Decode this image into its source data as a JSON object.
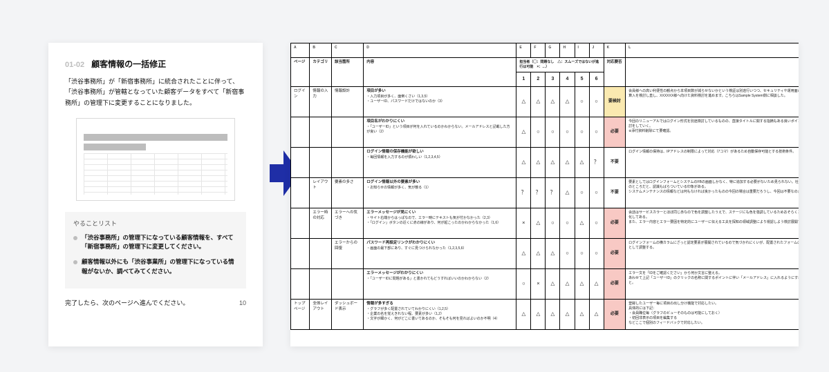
{
  "left_card": {
    "number": "01-02",
    "title": "顧客情報の一括修正",
    "description": "「渋谷事務所」が「新宿事務所」に統合されたことに伴って、「渋谷事務所」が管轄となっていた顧客データをすべて「新宿事務所」の管理下に変更することになりました。",
    "todo_title": "やることリスト",
    "todos": [
      "「渋谷事務所」の管理下になっている顧客情報を、すべて「新宿事務所」の管理下に変更してください。",
      "顧客情報以外にも「渋谷事業所」の管理下になっている情報がないか、調べてみてください。"
    ],
    "footer_text": "完了したら、次のページへ進んでください。",
    "page_number": "10"
  },
  "right_table": {
    "col_letters": [
      "A",
      "B",
      "C",
      "D",
      "E",
      "F",
      "G",
      "H",
      "I",
      "J",
      "K",
      "L"
    ],
    "headers": {
      "page": "ページ",
      "category": "カテゴリ",
      "location": "該当箇所",
      "content": "内容",
      "rating_legend": "担当者（◯：問題なし　△：スムーズではないが進行は可能　×：…）",
      "status": "対応要否",
      "comment": ""
    },
    "rating_nums": [
      "1",
      "2",
      "3",
      "4",
      "5",
      "6"
    ],
    "rows": [
      {
        "page": "ログイン",
        "category": "情報の入力",
        "location": "情報設計",
        "content_title": "項目が多い",
        "content_body": "・入力項目が多く、面倒くさい（1,3,5）\n・ユーザーID、パスワードだけではないのか（3）",
        "ratings": [
          "△",
          "△",
          "△",
          "△",
          "○",
          "○"
        ],
        "status": "要検討",
        "status_class": "status-yellow",
        "comment": "会員様への高い利便性の観点から本項目数が減らせないかという検証は別途行いつつ、セキュリティや運用面の観点からも項目算入を検討し直し、XXXXXX様へ向けた資料検討を進めます。こちらはSample System側に相談した。"
      },
      {
        "page": "",
        "category": "",
        "location": "",
        "content_title": "項目名がわかりにくい",
        "content_body": "・「ユーザーID」という項目が何を入れているのかわからない。メールアドレスと記載した方が良い（2）",
        "ratings": [
          "△",
          "○",
          "○",
          "○",
          "○",
          "○"
        ],
        "status": "必要",
        "status_class": "status-red",
        "comment": "今回のリニューアルではログイン形式を別途検討しているものの、直接タイトルに関する指摘もある良いポイントなので反映検討をしていく。\n※添付資料削除にて要確認。"
      },
      {
        "page": "",
        "category": "",
        "location": "",
        "content_title": "ログイン情報の保存機能が欲しい",
        "content_body": "・毎回情報を入力するのが煩わしい（1,2,3,4,5）",
        "ratings": [
          "△",
          "△",
          "△",
          "△",
          "△",
          "？"
        ],
        "status": "不要",
        "status_class": "",
        "comment": "ログイン情報の保持は、IPアドレスの制限によって対応（7コマ）があるため自動保存可能とする技術条件。"
      },
      {
        "page": "",
        "category": "レイアウト",
        "location": "要素の多さ",
        "content_title": "ログイン情報以外の要素が多い",
        "content_body": "・お知らせの情報が多く、気が散る（1）",
        "ratings": [
          "？",
          "？",
          "？",
          "△",
          "○",
          "○"
        ],
        "status": "不要",
        "status_class": "",
        "comment": "要素としてはログインフォームとシステムのFBの画面しかなく、特に追加する必要がないため見られない。社内の決議事項を今のところだと、認識もばらついている印象がある。\nシステムメンテナンスの情報などは何もなければ良かったものの今回の場合は重要だろうし、今回は不要なのかなと。"
      },
      {
        "page": "",
        "category": "エラー時の対応",
        "location": "エラーへの気づき",
        "content_title": "エラーメッセージが見にくい",
        "content_body": "・サイト右端からはっぱなので、エラー時にテキストも気が付かなかった（2,3）\n・「ログイン」ボタンの近くに赤の線があり、何が起こったのかわからなかった（1,6）",
        "ratings": [
          "×",
          "△",
          "○",
          "○",
          "△",
          "○"
        ],
        "status": "必要",
        "status_class": "status-red",
        "comment": "会話はサービスカラーとほぼ同じ赤なので色を調整したうえで、ステージにも色を強調しているためおそらくエラー視認性を強化してある。\nまた、エラー内容とエラー要因を特定的にユーザーに伝える工夫を探知の領域調整により視認しよう検討展開する。"
      },
      {
        "page": "",
        "category": "",
        "category2": "エラーからの回復",
        "location": "エラーからの回復",
        "content_title": "パスワード再設定リンクがわかりにくい",
        "content_body": "・画面の最下部にあり、すぐに見つけられなかった（1,2,3,5,6）",
        "ratings": [
          "△",
          "△",
          "△",
          "○",
          "○",
          "○"
        ],
        "status": "必要",
        "status_class": "status-red",
        "comment": "ログインフォームの横カラムにざっと認定要素が展開されているので気づかれにくいが、配置されたフォームの中にフォーム図として調整する。"
      },
      {
        "page": "",
        "category": "",
        "location": "",
        "content_title": "エラーメッセージがわかりにくい",
        "content_body": "・「ユーザーIDに問題がある」と書かれてもどうすればいいのかわからない（2）",
        "ratings": [
          "○",
          "×",
          "△",
          "△",
          "△",
          "△"
        ],
        "status": "必要",
        "status_class": "status-red",
        "comment": "エラー文を「IDをご確認ください」から何か文言に整える。\nあわせて上記「ユーザーID」のクリックの名称に関するポイントに伴い「メールアドレス」に入れるようにすれば直るかも、と。"
      },
      {
        "page": "トップページ",
        "category": "全体レイアウト",
        "location": "ダッシュボード表示",
        "content_title": "情報が多すぎる",
        "content_body": "・グラフが多く配置されていてわかりにくい（1,2,5）\n・企業の名を覚えきれない程、要素が多い（1,2）\n・文字が細かく、何がどこに書いてあるのか、そもそも何を見ればよいのか不明（4）",
        "ratings": [
          "△",
          "△",
          "△",
          "△",
          "△",
          "△"
        ],
        "status": "必要",
        "status_class": "status-red",
        "comment": "登録したユーザー毎に項目の出し分け機能で対応したい。\n具体的には下記：\n・会員職位毎（グラフのビューそのものは可能にしておく）\n・初回非表示の項目を編集する\nなどここで個別のフィードバックで対応したい。"
      }
    ]
  }
}
